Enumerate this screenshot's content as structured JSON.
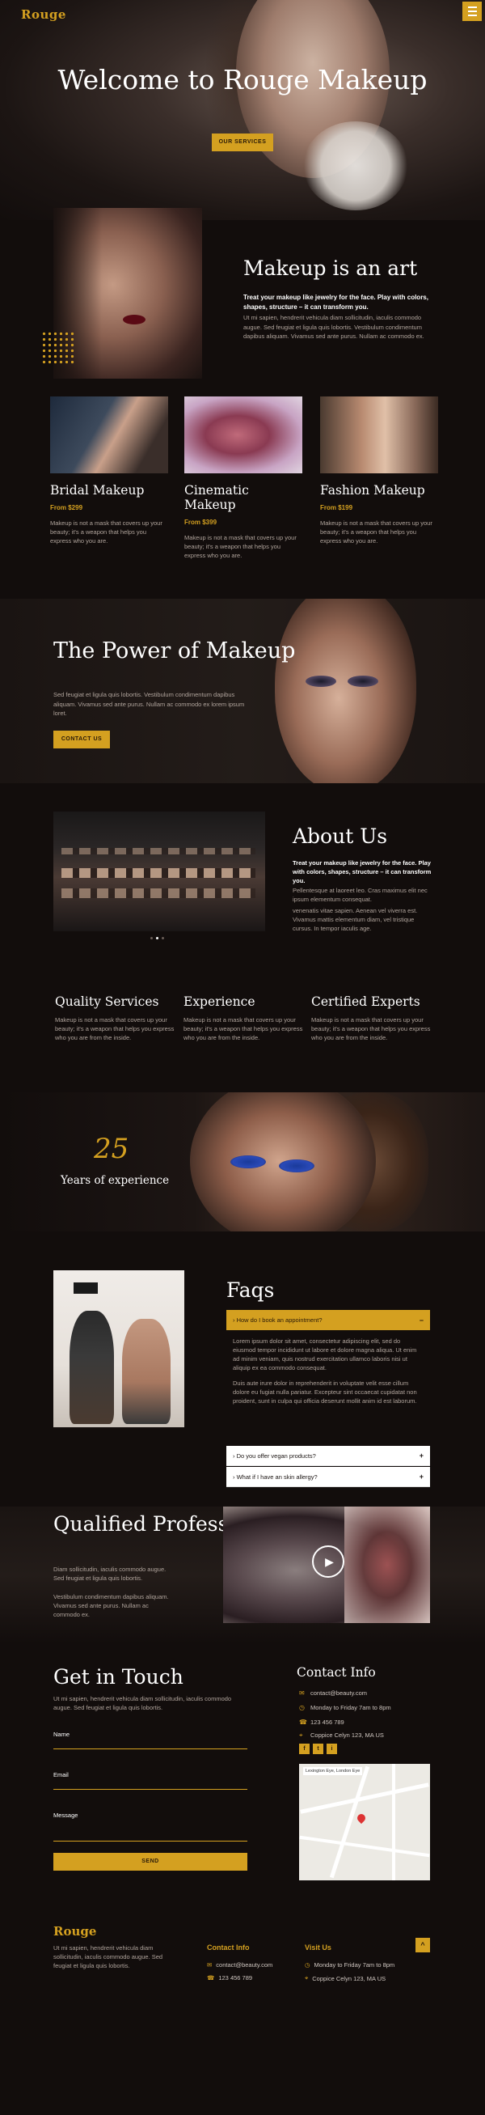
{
  "brand": {
    "logo": "Rouge"
  },
  "hero": {
    "title": "Welcome to Rouge Makeup",
    "cta": "OUR SERVICES"
  },
  "art": {
    "title": "Makeup is an art",
    "lead": "Treat your makeup like jewelry for the face. Play with colors, shapes, structure – it can transform you.",
    "body": "Ut mi sapien, hendrerit vehicula diam sollicitudin, iaculis commodo augue. Sed feugiat et ligula quis lobortis. Vestibulum condimentum dapibus aliquam. Vivamus sed ante purus. Nullam ac commodo ex."
  },
  "services": [
    {
      "title": "Bridal Makeup",
      "price": "From $299",
      "text": "Makeup is not a mask that covers up your beauty; it's a weapon that helps you express who you are."
    },
    {
      "title": "Cinematic Makeup",
      "price": "From $399",
      "text": "Makeup is not a mask that covers up your beauty; it's a weapon that helps you express who you are."
    },
    {
      "title": "Fashion Makeup",
      "price": "From $199",
      "text": "Makeup is not a mask that covers up your beauty; it's a weapon that helps you express who you are."
    }
  ],
  "power": {
    "title": "The Power of Makeup",
    "text": "Sed feugiat et ligula quis lobortis. Vestibulum condimentum dapibus aliquam. Vivamus sed ante purus. Nullam ac commodo ex lorem ipsum loret.",
    "cta": "CONTACT US"
  },
  "about": {
    "title": "About Us",
    "lead": "Treat your makeup like jewelry for the face. Play with colors, shapes, structure – it can transform you.",
    "p1": "Pellentesque at laoreet leo. Cras maximus elit nec ipsum elementum consequat.",
    "p2": "venenatis vitae sapien. Aenean vel viverra est. Vivamus mattis elementum diam, vel tristique cursus. In tempor iaculis age."
  },
  "features": [
    {
      "title": "Quality Services",
      "text": "Makeup is not a mask that covers up your beauty; it's a weapon that helps you express who you are from the inside."
    },
    {
      "title": "Experience",
      "text": "Makeup is not a mask that covers up your beauty; it's a weapon that helps you express who you are from the inside."
    },
    {
      "title": "Certified Experts",
      "text": "Makeup is not a mask that covers up your beauty; it's a weapon that helps you express who you are from the inside."
    }
  ],
  "years": {
    "number": "25",
    "label": "Years of experience"
  },
  "faq": {
    "title": "Faqs",
    "items": [
      {
        "question": "How do I book an appointment?",
        "open_icon": "−",
        "answer_p1": "Lorem ipsum dolor sit amet, consectetur adipiscing elit, sed do eiusmod tempor incididunt ut labore et dolore magna aliqua. Ut enim ad minim veniam, quis nostrud exercitation ullamco laboris nisi ut aliquip ex ea commodo consequat.",
        "answer_p2": "Duis aute irure dolor in reprehenderit in voluptate velit esse cillum dolore eu fugiat nulla pariatur. Excepteur sint occaecat cupidatat non proident, sunt in culpa qui officia deserunt mollit anim id est laborum."
      },
      {
        "question": "Do you offer vegan products?",
        "icon": "+"
      },
      {
        "question": "What if I have an skin allergy?",
        "icon": "+"
      }
    ]
  },
  "pros": {
    "title": "Qualified Professionals",
    "p1": "Diam sollicitudin, iaculis commodo augue. Sed feugiat et ligula quis lobortis.",
    "p2": "Vestibulum condimentum dapibus aliquam. Vivamus sed ante purus. Nullam ac commodo ex."
  },
  "contact": {
    "title": "Get in Touch",
    "intro": "Ut mi sapien, hendrerit vehicula diam sollicitudin, iaculis commodo augue. Sed feugiat et ligula quis lobortis.",
    "name_label": "Name",
    "email_label": "Email",
    "message_label": "Message",
    "submit": "SEND",
    "info_title": "Contact Info",
    "email": "contact@beauty.com",
    "hours": "Monday to Friday 7am to 8pm",
    "phone": "123 456 789",
    "address": "Coppice Celyn 123, MA US",
    "socials": [
      "f",
      "t",
      "i"
    ],
    "map_label": "Lexington Eye, London Eye"
  },
  "footer": {
    "logo": "Rouge",
    "text": "Ut mi sapien, hendrerit vehicula diam sollicitudin, iaculis commodo augue. Sed feugiat et ligula quis lobortis.",
    "contact_title": "Contact Info",
    "email": "contact@beauty.com",
    "phone": "123 456 789",
    "visit_title": "Visit Us",
    "hours": "Monday to Friday 7am to 8pm",
    "address": "Coppice Celyn 123, MA US",
    "to_top": "^"
  }
}
